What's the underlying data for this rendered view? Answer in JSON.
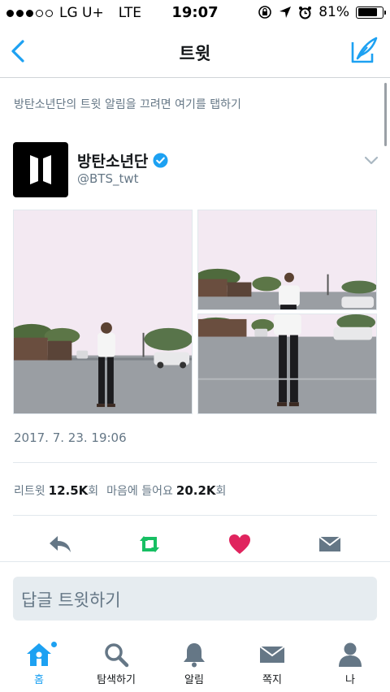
{
  "status_bar": {
    "carrier": "LG U+",
    "network": "LTE",
    "time": "19:07",
    "battery": "81%",
    "battery_level": 0.81
  },
  "nav": {
    "title": "트윗",
    "back_icon": "chevron-left-icon",
    "compose_icon": "compose-tweet-icon"
  },
  "notification_link": "방탄소년단의 트윗 알림을 끄려면 여기를 탭하기",
  "tweet": {
    "author_name": "방탄소년단",
    "author_handle": "@BTS_twt",
    "timestamp": "2017. 7. 23. 19:06",
    "retweet_label": "리트윗",
    "retweet_count": "12.5K",
    "retweet_unit": "회",
    "like_label": "마음에 들어요",
    "like_count": "20.2K",
    "like_unit": "회"
  },
  "actions": [
    {
      "name": "reply-icon",
      "color": "#657786"
    },
    {
      "name": "retweet-icon",
      "color": "#17bf63"
    },
    {
      "name": "heart-icon",
      "color": "#e0245e"
    },
    {
      "name": "direct-message-icon",
      "color": "#657786"
    }
  ],
  "reply_placeholder": "답글 트윗하기",
  "tabs": [
    {
      "label": "홈",
      "icon": "home-icon",
      "active": true
    },
    {
      "label": "탐색하기",
      "icon": "search-icon",
      "active": false
    },
    {
      "label": "알림",
      "icon": "bell-icon",
      "active": false
    },
    {
      "label": "쪽지",
      "icon": "envelope-icon",
      "active": false
    },
    {
      "label": "나",
      "icon": "person-icon",
      "active": false
    }
  ],
  "colors": {
    "accent": "#1da1f2",
    "muted_text": "#657786",
    "retweet_green": "#17bf63",
    "like_red": "#e0245e"
  }
}
